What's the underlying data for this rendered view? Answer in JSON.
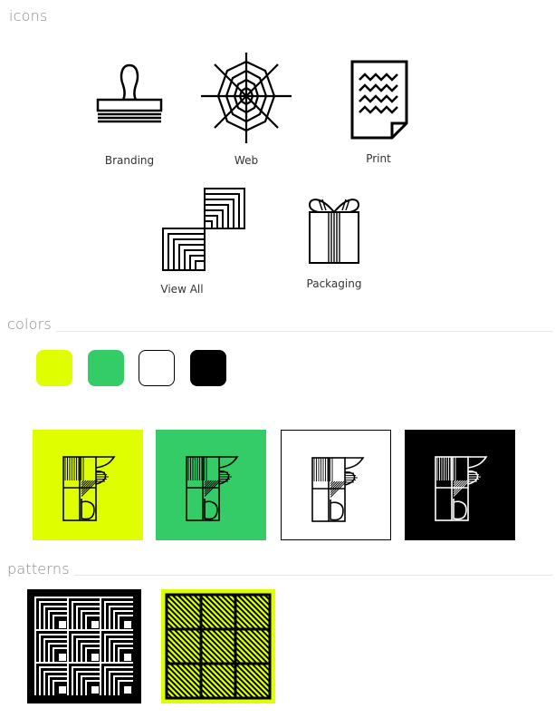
{
  "sections": {
    "icons_title": "icons",
    "colors_title": "colors",
    "patterns_title": "patterns"
  },
  "icons": [
    {
      "label": "Branding",
      "icon": "stamp-icon"
    },
    {
      "label": "Web",
      "icon": "spider-web-icon"
    },
    {
      "label": "Print",
      "icon": "paper-icon"
    },
    {
      "label": "View All",
      "icon": "squares-icon"
    },
    {
      "label": "Packaging",
      "icon": "gift-box-icon"
    }
  ],
  "colors": {
    "swatches": [
      "#dfff00",
      "#33cc66",
      "#ffffff",
      "#000000"
    ]
  },
  "logo_tiles": [
    {
      "bg": "#dfff00",
      "fg": "#000000",
      "border": "none"
    },
    {
      "bg": "#33cc66",
      "fg": "#000000",
      "border": "none"
    },
    {
      "bg": "#ffffff",
      "fg": "#000000",
      "border": "#000000"
    },
    {
      "bg": "#000000",
      "fg": "#ffffff",
      "border": "none"
    }
  ],
  "patterns": [
    {
      "bg": "#000000",
      "fg": "#ffffff",
      "style": "nested-corners"
    },
    {
      "bg": "#dfff00",
      "fg": "#000000",
      "style": "diagonal-hatch"
    }
  ]
}
